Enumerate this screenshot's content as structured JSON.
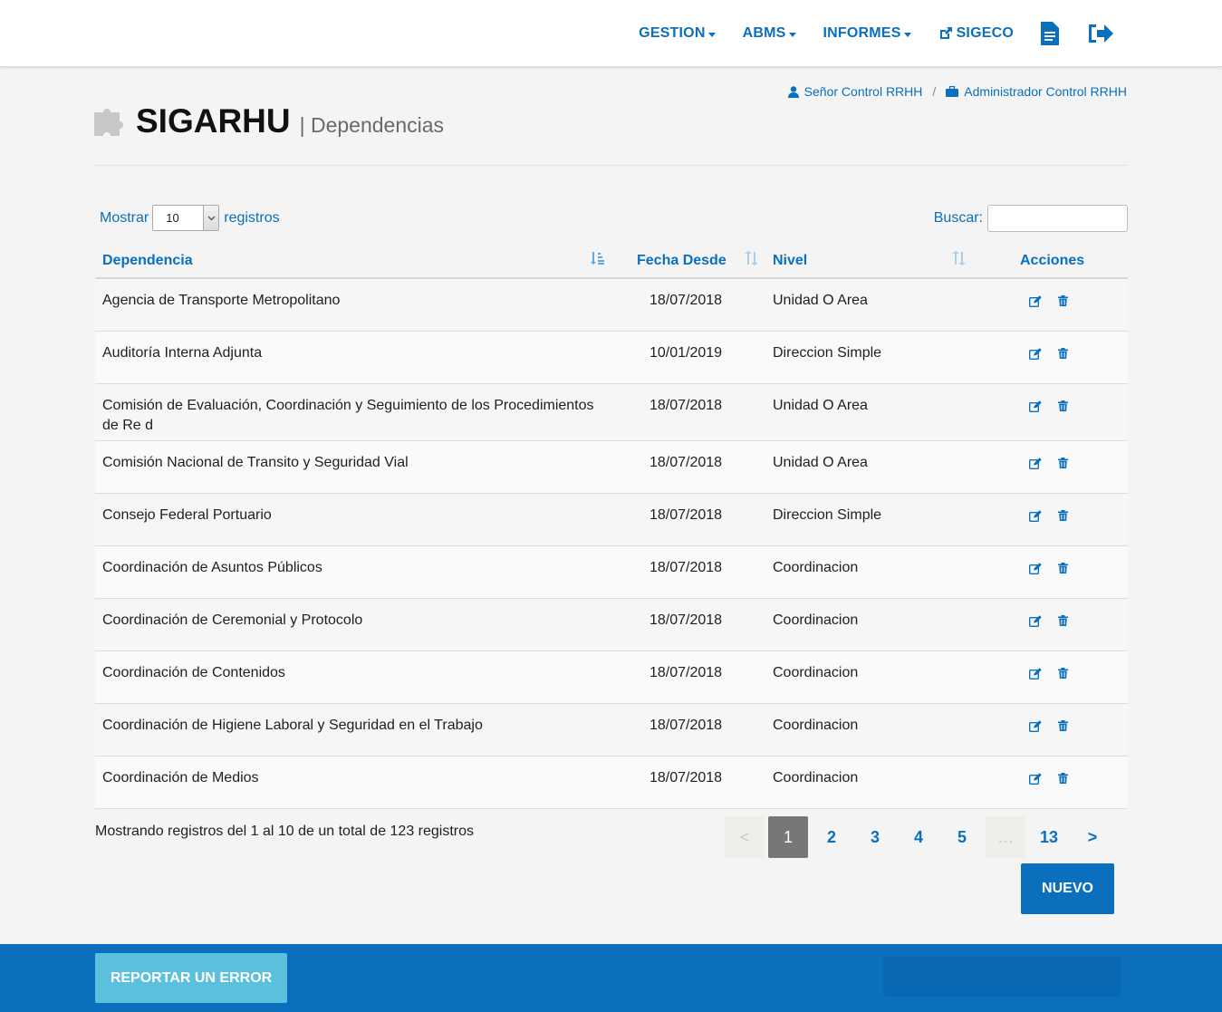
{
  "nav": {
    "gestion": "GESTION",
    "abms": "ABMS",
    "informes": "INFORMES",
    "sigeco": "SIGECO"
  },
  "user": {
    "name": "Señor Control RRHH",
    "role": "Administrador Control RRHH"
  },
  "header": {
    "title": "SIGARHU",
    "subtitle": "| Dependencias"
  },
  "controls": {
    "show_label": "Mostrar",
    "show_value": "10",
    "records_label": "registros",
    "search_label": "Buscar:"
  },
  "table": {
    "columns": [
      "Dependencia",
      "Fecha Desde",
      "Nivel",
      "Acciones"
    ],
    "rows": [
      {
        "dependencia": "Agencia de Transporte Metropolitano",
        "fecha": "18/07/2018",
        "nivel": "Unidad O Area"
      },
      {
        "dependencia": "Auditoría Interna Adjunta",
        "fecha": "10/01/2019",
        "nivel": "Direccion Simple"
      },
      {
        "dependencia": "Comisión de Evaluación, Coordinación y Seguimiento de los Procedimientos de Re d",
        "fecha": "18/07/2018",
        "nivel": "Unidad O Area"
      },
      {
        "dependencia": "Comisión Nacional de Transito y Seguridad Vial",
        "fecha": "18/07/2018",
        "nivel": "Unidad O Area"
      },
      {
        "dependencia": "Consejo Federal Portuario",
        "fecha": "18/07/2018",
        "nivel": "Direccion Simple"
      },
      {
        "dependencia": "Coordinación de Asuntos Públicos",
        "fecha": "18/07/2018",
        "nivel": "Coordinacion"
      },
      {
        "dependencia": "Coordinación de Ceremonial y Protocolo",
        "fecha": "18/07/2018",
        "nivel": "Coordinacion"
      },
      {
        "dependencia": "Coordinación de Contenidos",
        "fecha": "18/07/2018",
        "nivel": "Coordinacion"
      },
      {
        "dependencia": "Coordinación de Higiene Laboral y Seguridad en el Trabajo",
        "fecha": "18/07/2018",
        "nivel": "Coordinacion"
      },
      {
        "dependencia": "Coordinación de Medios",
        "fecha": "18/07/2018",
        "nivel": "Coordinacion"
      }
    ]
  },
  "info": "Mostrando registros del 1 al 10 de un total de 123 registros",
  "pagination": {
    "prev": "<",
    "pages": [
      "1",
      "2",
      "3",
      "4",
      "5"
    ],
    "dots": "…",
    "last": "13",
    "next": ">"
  },
  "buttons": {
    "nuevo": "NUEVO",
    "reportar": "REPORTAR UN ERROR"
  },
  "colors": {
    "primary": "#0a6fbd",
    "info_button": "#5bc0de",
    "active_page": "#777777"
  }
}
